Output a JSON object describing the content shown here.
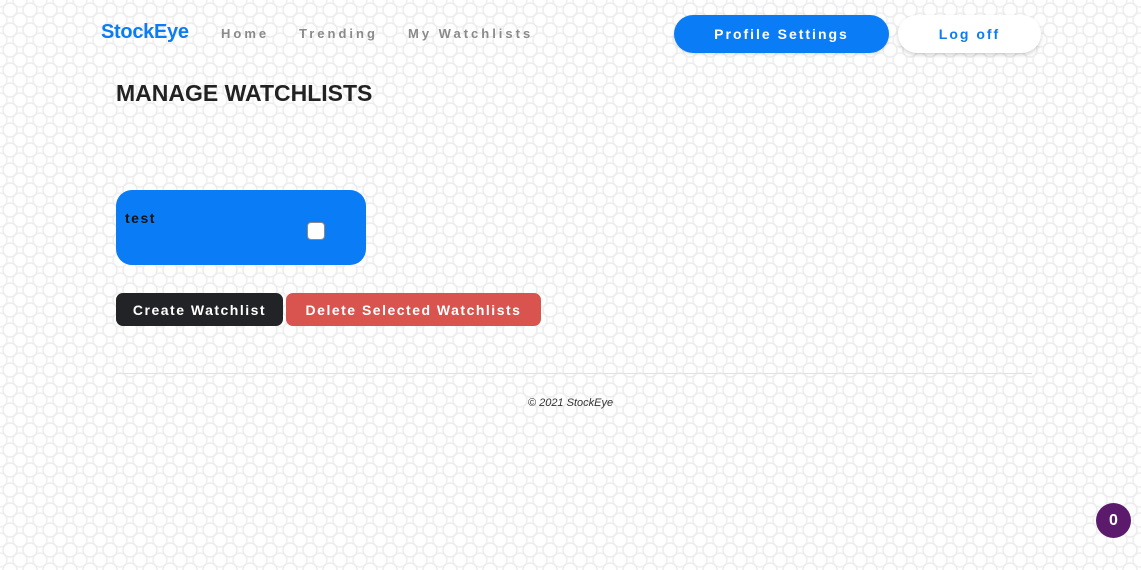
{
  "header": {
    "brand": "StockEye",
    "nav": {
      "home": "Home",
      "trending": "Trending",
      "my_watchlists": "My Watchlists"
    },
    "profile_settings_label": "Profile Settings",
    "log_off_label": "Log off"
  },
  "main": {
    "title": "MANAGE WATCHLISTS",
    "watchlists": [
      {
        "name": "test",
        "selected": false
      }
    ],
    "create_label": "Create Watchlist",
    "delete_label": "Delete Selected Watchlists"
  },
  "footer": {
    "copyright": "© 2021 StockEye"
  },
  "badge": {
    "count": "0"
  },
  "colors": {
    "brand_blue": "#0a7cf5",
    "dark_button": "#222326",
    "danger": "#d9534f",
    "badge": "#5b1a6b"
  }
}
